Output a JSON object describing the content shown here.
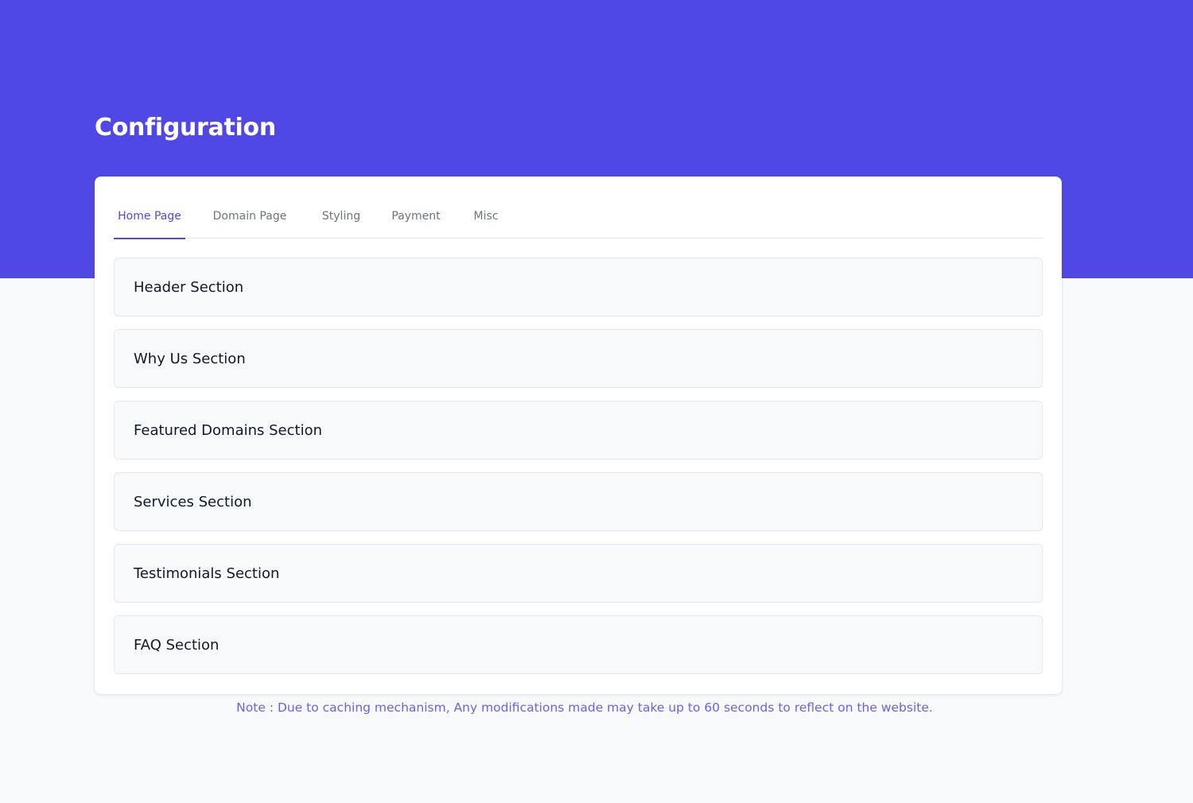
{
  "colors": {
    "primary": "#5048e5",
    "background": "#f8f9fb",
    "card": "#ffffff",
    "text_dark": "#121828",
    "text_muted": "#6b7280"
  },
  "page": {
    "title": "Configuration"
  },
  "tabs": [
    {
      "label": "Home Page",
      "active": true
    },
    {
      "label": "Domain Page",
      "active": false
    },
    {
      "label": "Styling",
      "active": false
    },
    {
      "label": "Payment",
      "active": false
    },
    {
      "label": "Misc",
      "active": false
    }
  ],
  "sections": [
    {
      "label": "Header Section"
    },
    {
      "label": "Why Us Section"
    },
    {
      "label": "Featured Domains Section"
    },
    {
      "label": "Services Section"
    },
    {
      "label": "Testimonials Section"
    },
    {
      "label": "FAQ Section"
    }
  ],
  "note": {
    "text": "Note : Due to caching mechanism, Any modifications made may take up to 60 seconds to reflect on the website."
  }
}
